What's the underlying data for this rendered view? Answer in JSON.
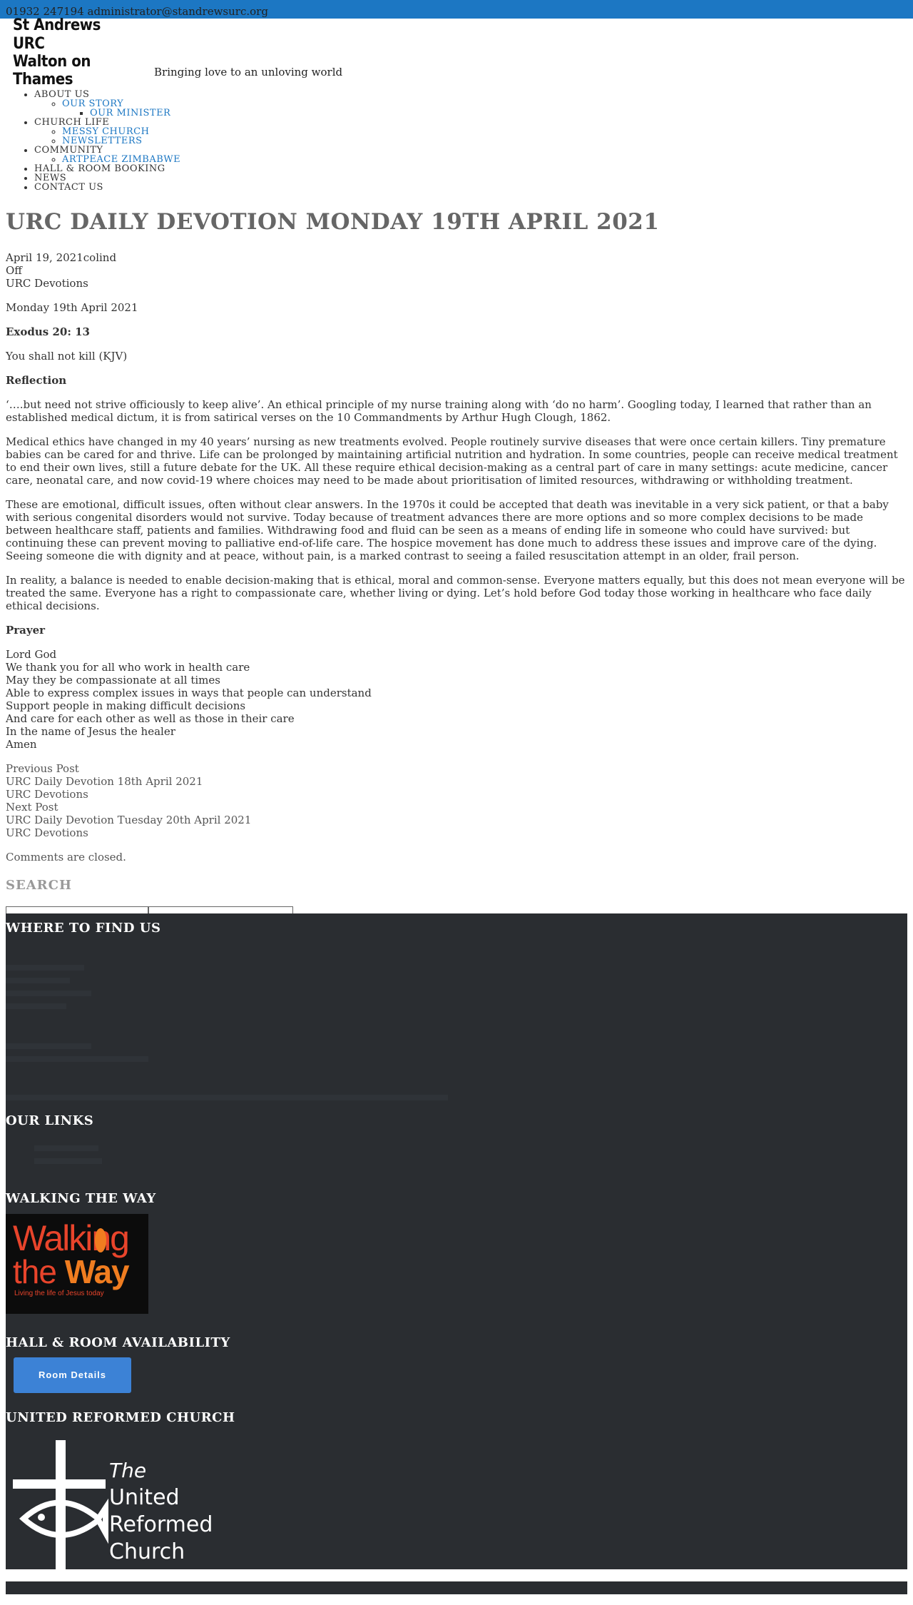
{
  "topbar": {
    "contact": "01932 247194 administrator@standrewsurc.org"
  },
  "header": {
    "logo_line1": "St Andrews URC",
    "logo_line2": "Walton on Thames",
    "tagline": "Bringing love to an unloving world"
  },
  "nav": {
    "about": "ABOUT US",
    "our_story": "OUR STORY",
    "our_minister": "OUR MINISTER",
    "church_life": "CHURCH LIFE",
    "messy_church": "MESSY CHURCH",
    "newsletters": "NEWSLETTERS",
    "community": "COMMUNITY",
    "artpeace": "ARTPEACE ZIMBABWE",
    "hall_booking": "HALL & ROOM BOOKING",
    "news": "NEWS",
    "contact": "CONTACT US"
  },
  "post": {
    "title": "URC DAILY DEVOTION MONDAY 19TH APRIL 2021",
    "meta_date_author": "April 19, 2021colind",
    "meta_comments": "Off",
    "meta_category": "URC Devotions",
    "date_line": "Monday 19th April 2021",
    "scripture_ref": "Exodus 20: 13",
    "scripture_text": "You shall not kill  (KJV)",
    "reflection_heading": "Reflection",
    "para1": "‘….but need not strive officiously to keep alive’.  An ethical principle of my nurse training along with ‘do no harm’.  Googling today, I learned that rather than an established medical dictum, it is from satirical verses on the 10 Commandments by Arthur Hugh Clough, 1862.",
    "para2": "Medical ethics have changed in my 40 years’ nursing as new treatments evolved.  People routinely survive diseases that were once certain killers.  Tiny premature babies can be cared for and thrive.  Life can be prolonged by maintaining artificial nutrition and hydration.  In some countries, people can receive medical treatment to end their own lives, still a future debate for the UK. All these require ethical decision-making as a central part of care in many settings: acute medicine, cancer care, neonatal care, and now covid-19 where choices may need to be made about prioritisation of limited resources, withdrawing or withholding treatment.",
    "para3": "These are emotional, difficult issues, often without clear answers.  In the 1970s it could be accepted that death was inevitable in a very sick patient, or that a baby with serious congenital disorders would not survive. Today because of treatment advances there are more options and so more complex decisions to be made between healthcare staff, patients and families.  Withdrawing food and fluid can be seen as a means of ending life in someone who could have survived: but continuing these can prevent moving to palliative end-of-life care.  The hospice movement has done much to address these issues and improve care of the dying.  Seeing someone die with dignity and at peace, without pain, is a marked contrast to seeing a failed resuscitation attempt in an older, frail person.",
    "para4": "In reality, a balance is needed to enable decision-making that is ethical, moral and common-sense.  Everyone matters equally, but this does not mean everyone will be treated the same.  Everyone has a right to compassionate care, whether living or dying.  Let’s hold before God today those working in healthcare who face daily ethical decisions.",
    "prayer_heading": "Prayer",
    "prayer_lines": [
      "Lord God",
      "We thank you for all who work in health care",
      "May they be compassionate at all times",
      "Able to express complex issues in ways that people can understand",
      "Support people in making difficult decisions",
      "And care for each other as well as those in their care",
      "In the name of Jesus the healer",
      "Amen"
    ]
  },
  "postnav": {
    "prev_label": "Previous Post",
    "prev_title": "URC Daily Devotion 18th April 2021",
    "prev_category": "URC Devotions",
    "next_label": "Next Post",
    "next_title": "URC Daily Devotion Tuesday 20th April 2021",
    "next_category": "URC Devotions"
  },
  "comments_closed": "Comments are closed.",
  "search": {
    "title": "SEARCH"
  },
  "footer": {
    "where_title": "WHERE TO FIND US",
    "links_title": "OUR LINKS",
    "walking_title": "WALKING THE WAY",
    "walking_logo_line1": "Walking",
    "walking_logo_line2a": "the ",
    "walking_logo_line2b": "Way",
    "walking_logo_sub": "Living the life of Jesus today",
    "hall_title": "HALL & ROOM AVAILABILITY",
    "room_button": "Room Details",
    "urc_title": "UNITED REFORMED CHURCH",
    "urc_logo_the": "The",
    "urc_logo_united": "United",
    "urc_logo_reformed": "Reformed",
    "urc_logo_church": "Church"
  },
  "colors": {
    "accent": "#1c77c3",
    "footer_bg": "#2a2d31",
    "button": "#3c82d6"
  }
}
